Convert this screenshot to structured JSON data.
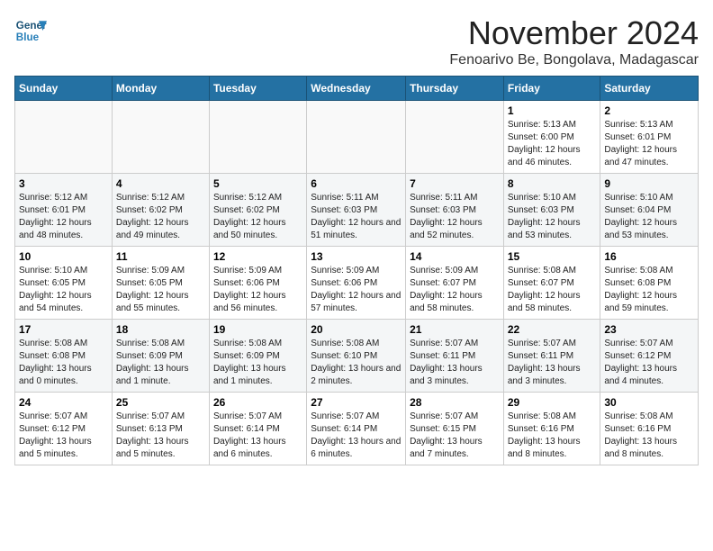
{
  "logo": {
    "line1": "General",
    "line2": "Blue"
  },
  "title": "November 2024",
  "location": "Fenoarivo Be, Bongolava, Madagascar",
  "weekdays": [
    "Sunday",
    "Monday",
    "Tuesday",
    "Wednesday",
    "Thursday",
    "Friday",
    "Saturday"
  ],
  "weeks": [
    [
      {
        "day": "",
        "info": ""
      },
      {
        "day": "",
        "info": ""
      },
      {
        "day": "",
        "info": ""
      },
      {
        "day": "",
        "info": ""
      },
      {
        "day": "",
        "info": ""
      },
      {
        "day": "1",
        "info": "Sunrise: 5:13 AM\nSunset: 6:00 PM\nDaylight: 12 hours and 46 minutes."
      },
      {
        "day": "2",
        "info": "Sunrise: 5:13 AM\nSunset: 6:01 PM\nDaylight: 12 hours and 47 minutes."
      }
    ],
    [
      {
        "day": "3",
        "info": "Sunrise: 5:12 AM\nSunset: 6:01 PM\nDaylight: 12 hours and 48 minutes."
      },
      {
        "day": "4",
        "info": "Sunrise: 5:12 AM\nSunset: 6:02 PM\nDaylight: 12 hours and 49 minutes."
      },
      {
        "day": "5",
        "info": "Sunrise: 5:12 AM\nSunset: 6:02 PM\nDaylight: 12 hours and 50 minutes."
      },
      {
        "day": "6",
        "info": "Sunrise: 5:11 AM\nSunset: 6:03 PM\nDaylight: 12 hours and 51 minutes."
      },
      {
        "day": "7",
        "info": "Sunrise: 5:11 AM\nSunset: 6:03 PM\nDaylight: 12 hours and 52 minutes."
      },
      {
        "day": "8",
        "info": "Sunrise: 5:10 AM\nSunset: 6:03 PM\nDaylight: 12 hours and 53 minutes."
      },
      {
        "day": "9",
        "info": "Sunrise: 5:10 AM\nSunset: 6:04 PM\nDaylight: 12 hours and 53 minutes."
      }
    ],
    [
      {
        "day": "10",
        "info": "Sunrise: 5:10 AM\nSunset: 6:05 PM\nDaylight: 12 hours and 54 minutes."
      },
      {
        "day": "11",
        "info": "Sunrise: 5:09 AM\nSunset: 6:05 PM\nDaylight: 12 hours and 55 minutes."
      },
      {
        "day": "12",
        "info": "Sunrise: 5:09 AM\nSunset: 6:06 PM\nDaylight: 12 hours and 56 minutes."
      },
      {
        "day": "13",
        "info": "Sunrise: 5:09 AM\nSunset: 6:06 PM\nDaylight: 12 hours and 57 minutes."
      },
      {
        "day": "14",
        "info": "Sunrise: 5:09 AM\nSunset: 6:07 PM\nDaylight: 12 hours and 58 minutes."
      },
      {
        "day": "15",
        "info": "Sunrise: 5:08 AM\nSunset: 6:07 PM\nDaylight: 12 hours and 58 minutes."
      },
      {
        "day": "16",
        "info": "Sunrise: 5:08 AM\nSunset: 6:08 PM\nDaylight: 12 hours and 59 minutes."
      }
    ],
    [
      {
        "day": "17",
        "info": "Sunrise: 5:08 AM\nSunset: 6:08 PM\nDaylight: 13 hours and 0 minutes."
      },
      {
        "day": "18",
        "info": "Sunrise: 5:08 AM\nSunset: 6:09 PM\nDaylight: 13 hours and 1 minute."
      },
      {
        "day": "19",
        "info": "Sunrise: 5:08 AM\nSunset: 6:09 PM\nDaylight: 13 hours and 1 minutes."
      },
      {
        "day": "20",
        "info": "Sunrise: 5:08 AM\nSunset: 6:10 PM\nDaylight: 13 hours and 2 minutes."
      },
      {
        "day": "21",
        "info": "Sunrise: 5:07 AM\nSunset: 6:11 PM\nDaylight: 13 hours and 3 minutes."
      },
      {
        "day": "22",
        "info": "Sunrise: 5:07 AM\nSunset: 6:11 PM\nDaylight: 13 hours and 3 minutes."
      },
      {
        "day": "23",
        "info": "Sunrise: 5:07 AM\nSunset: 6:12 PM\nDaylight: 13 hours and 4 minutes."
      }
    ],
    [
      {
        "day": "24",
        "info": "Sunrise: 5:07 AM\nSunset: 6:12 PM\nDaylight: 13 hours and 5 minutes."
      },
      {
        "day": "25",
        "info": "Sunrise: 5:07 AM\nSunset: 6:13 PM\nDaylight: 13 hours and 5 minutes."
      },
      {
        "day": "26",
        "info": "Sunrise: 5:07 AM\nSunset: 6:14 PM\nDaylight: 13 hours and 6 minutes."
      },
      {
        "day": "27",
        "info": "Sunrise: 5:07 AM\nSunset: 6:14 PM\nDaylight: 13 hours and 6 minutes."
      },
      {
        "day": "28",
        "info": "Sunrise: 5:07 AM\nSunset: 6:15 PM\nDaylight: 13 hours and 7 minutes."
      },
      {
        "day": "29",
        "info": "Sunrise: 5:08 AM\nSunset: 6:16 PM\nDaylight: 13 hours and 8 minutes."
      },
      {
        "day": "30",
        "info": "Sunrise: 5:08 AM\nSunset: 6:16 PM\nDaylight: 13 hours and 8 minutes."
      }
    ]
  ]
}
